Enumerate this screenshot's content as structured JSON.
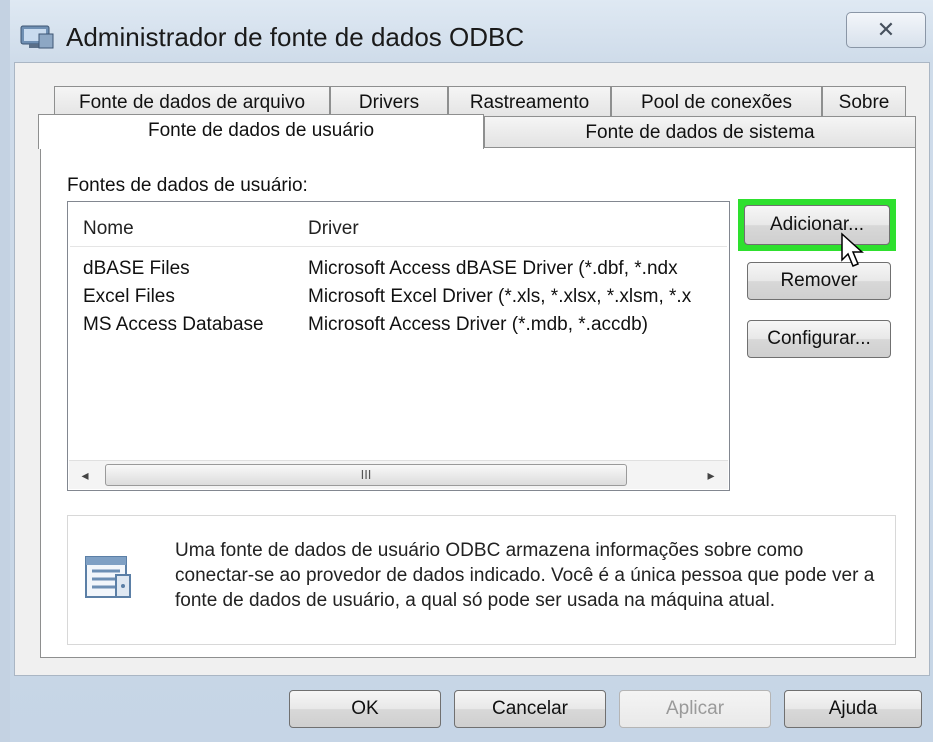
{
  "window": {
    "title": "Administrador de fonte de dados ODBC",
    "close_glyph": "✕"
  },
  "tabs_back": [
    {
      "label": "Fonte de dados de arquivo"
    },
    {
      "label": "Drivers"
    },
    {
      "label": "Rastreamento"
    },
    {
      "label": "Pool de conexões"
    },
    {
      "label": "Sobre"
    }
  ],
  "tabs_front": [
    {
      "label": "Fonte de dados de usuário",
      "active": true
    },
    {
      "label": "Fonte de dados de sistema",
      "active": false
    }
  ],
  "panel": {
    "label": "Fontes de dados de usuário:",
    "columns": [
      "Nome",
      "Driver"
    ],
    "rows": [
      {
        "name": "dBASE Files",
        "driver": "Microsoft Access dBASE Driver (*.dbf, *.ndx"
      },
      {
        "name": "Excel Files",
        "driver": "Microsoft Excel Driver (*.xls, *.xlsx, *.xlsm, *.x"
      },
      {
        "name": "MS Access Database",
        "driver": "Microsoft Access Driver (*.mdb, *.accdb)"
      }
    ],
    "scroll_thumb_grip": "III",
    "scroll_left": "◂",
    "scroll_right": "▸"
  },
  "side_buttons": {
    "add": "Adicionar...",
    "remove": "Remover",
    "configure": "Configurar..."
  },
  "info": {
    "text": "Uma fonte de dados de usuário ODBC armazena informações sobre como conectar-se ao provedor de dados indicado. Você é a única pessoa que pode ver a fonte de dados de usuário, a qual só pode ser usada na máquina atual."
  },
  "footer": {
    "ok": "OK",
    "cancel": "Cancelar",
    "apply": "Aplicar",
    "help": "Ajuda"
  },
  "colors": {
    "highlight": "#2ee02e",
    "disabled_text": "#9a9a9a"
  }
}
